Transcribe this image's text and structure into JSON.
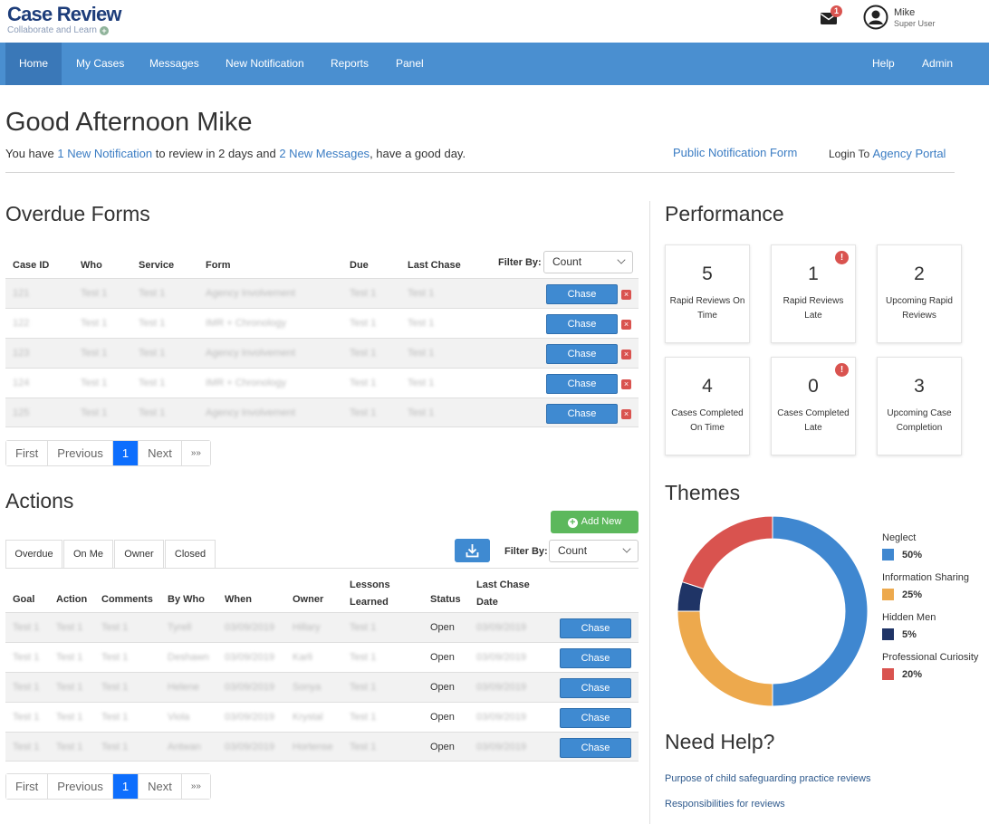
{
  "header": {
    "logo_title": "Case Review",
    "logo_subtitle": "Collaborate and Learn",
    "mail_badge": "1",
    "user_name": "Mike",
    "user_role": "Super User"
  },
  "nav": {
    "items": [
      "Home",
      "My Cases",
      "Messages",
      "New Notification",
      "Reports",
      "Panel"
    ],
    "right_items": [
      "Help",
      "Admin"
    ],
    "active": "Home"
  },
  "greeting": {
    "title": "Good Afternoon Mike",
    "line_prefix": "You have ",
    "notification_link": "1 New Notification",
    "line_middle": " to review in 2 days and ",
    "messages_link": "2 New Messages",
    "line_suffix": ", have a good day.",
    "public_form_link": "Public Notification Form",
    "login_prefix": "Login To ",
    "agency_portal_link": "Agency Portal"
  },
  "overdue": {
    "title": "Overdue Forms",
    "columns": [
      "Case ID",
      "Who",
      "Service",
      "Form",
      "Due",
      "Last Chase"
    ],
    "filter_label": "Filter By:",
    "filter_value": "Count",
    "chase_label": "Chase",
    "remove_label": "×",
    "rows": [
      [
        "121",
        "Test 1",
        "Test 1",
        "Agency Involvement",
        "Test 1",
        "Test 1"
      ],
      [
        "122",
        "Test 1",
        "Test 1",
        "IMR + Chronology",
        "Test 1",
        "Test 1"
      ],
      [
        "123",
        "Test 1",
        "Test 1",
        "Agency Involvement",
        "Test 1",
        "Test 1"
      ],
      [
        "124",
        "Test 1",
        "Test 1",
        "IMR + Chronology",
        "Test 1",
        "Test 1"
      ],
      [
        "125",
        "Test 1",
        "Test 1",
        "Agency Involvement",
        "Test 1",
        "Test 1"
      ]
    ],
    "pager": [
      "First",
      "Previous",
      "1",
      "Next",
      "»»"
    ]
  },
  "actions": {
    "title": "Actions",
    "add_new_label": "Add New",
    "tabs": [
      "Overdue",
      "On Me",
      "Owner",
      "Closed"
    ],
    "filter_label": "Filter By:",
    "filter_value": "Count",
    "columns": [
      "Goal",
      "Action",
      "Comments",
      "By Who",
      "When",
      "Owner",
      "Lessons Learned",
      "Status",
      "Last Chase Date"
    ],
    "chase_label": "Chase",
    "rows": [
      [
        "Test 1",
        "Test 1",
        "Test 1",
        "Tyrell",
        "03/09/2019",
        "Hillary",
        "Test 1",
        "Open",
        "03/09/2019"
      ],
      [
        "Test 1",
        "Test 1",
        "Test 1",
        "Deshawn",
        "03/09/2019",
        "Karli",
        "Test 1",
        "Open",
        "03/09/2019"
      ],
      [
        "Test 1",
        "Test 1",
        "Test 1",
        "Helene",
        "03/09/2019",
        "Sonya",
        "Test 1",
        "Open",
        "03/09/2019"
      ],
      [
        "Test 1",
        "Test 1",
        "Test 1",
        "Viola",
        "03/09/2019",
        "Krystal",
        "Test 1",
        "Open",
        "03/09/2019"
      ],
      [
        "Test 1",
        "Test 1",
        "Test 1",
        "Antwan",
        "03/09/2019",
        "Hortense",
        "Test 1",
        "Open",
        "03/09/2019"
      ]
    ],
    "pager": [
      "First",
      "Previous",
      "1",
      "Next",
      "»»"
    ]
  },
  "performance": {
    "title": "Performance",
    "cards": [
      {
        "value": "5",
        "label": "Rapid Reviews On Time",
        "alert": false
      },
      {
        "value": "1",
        "label": "Rapid Reviews Late",
        "alert": true
      },
      {
        "value": "2",
        "label": "Upcoming Rapid Reviews",
        "alert": false
      },
      {
        "value": "4",
        "label": "Cases Completed On Time",
        "alert": false
      },
      {
        "value": "0",
        "label": "Cases Completed Late",
        "alert": true
      },
      {
        "value": "3",
        "label": "Upcoming Case Completion",
        "alert": false
      }
    ],
    "alert_symbol": "!"
  },
  "themes": {
    "title": "Themes",
    "legend": [
      {
        "name": "Neglect",
        "pct": "50%",
        "color": "#3f87d0"
      },
      {
        "name": "Information Sharing",
        "pct": "25%",
        "color": "#eda94d"
      },
      {
        "name": "Hidden Men",
        "pct": "5%",
        "color": "#1f3466"
      },
      {
        "name": "Professional Curiosity",
        "pct": "20%",
        "color": "#d9534f"
      }
    ]
  },
  "chart_data": {
    "type": "pie",
    "categories": [
      "Neglect",
      "Information Sharing",
      "Hidden Men",
      "Professional Curiosity"
    ],
    "values": [
      50,
      25,
      5,
      20
    ],
    "colors": [
      "#3f87d0",
      "#eda94d",
      "#1f3466",
      "#d9534f"
    ],
    "title": "Themes",
    "legend_position": "right"
  },
  "help": {
    "title": "Need Help?",
    "links": [
      "Purpose of child safeguarding practice reviews",
      "Responsibilities for reviews"
    ]
  }
}
